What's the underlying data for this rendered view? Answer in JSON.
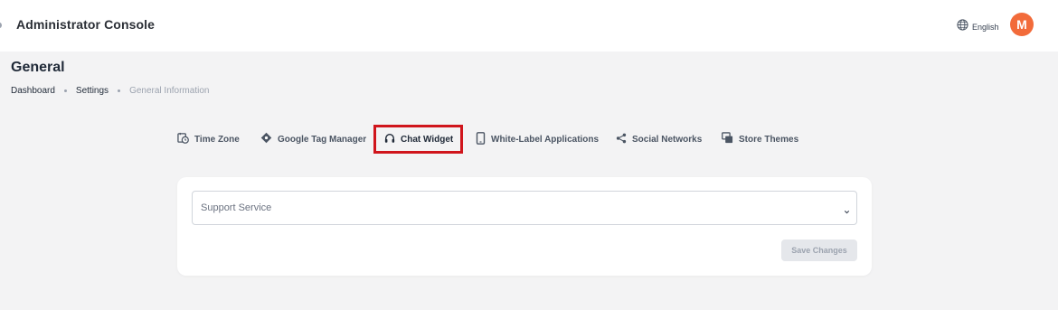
{
  "app": {
    "title": "Administrator Console",
    "language": "English",
    "avatar_initial": "M"
  },
  "page": {
    "title": "General",
    "breadcrumb": [
      "Dashboard",
      "Settings",
      "General Information"
    ]
  },
  "tabs": [
    {
      "label": "Time Zone",
      "icon": "clock-calendar-icon"
    },
    {
      "label": "Google Tag Manager",
      "icon": "tag-manager-diamond-icon"
    },
    {
      "label": "Chat Widget",
      "icon": "headset-icon",
      "active": true
    },
    {
      "label": "White-Label Applications",
      "icon": "mobile-phone-icon"
    },
    {
      "label": "Social Networks",
      "icon": "share-icon"
    },
    {
      "label": "Store Themes",
      "icon": "store-themes-icon"
    }
  ],
  "form": {
    "support_service_placeholder": "Support Service",
    "support_service_value": "",
    "save_label": "Save Changes"
  },
  "colors": {
    "accent": "#f26b3a",
    "highlight": "#d0151c",
    "background": "#f3f3f4"
  }
}
